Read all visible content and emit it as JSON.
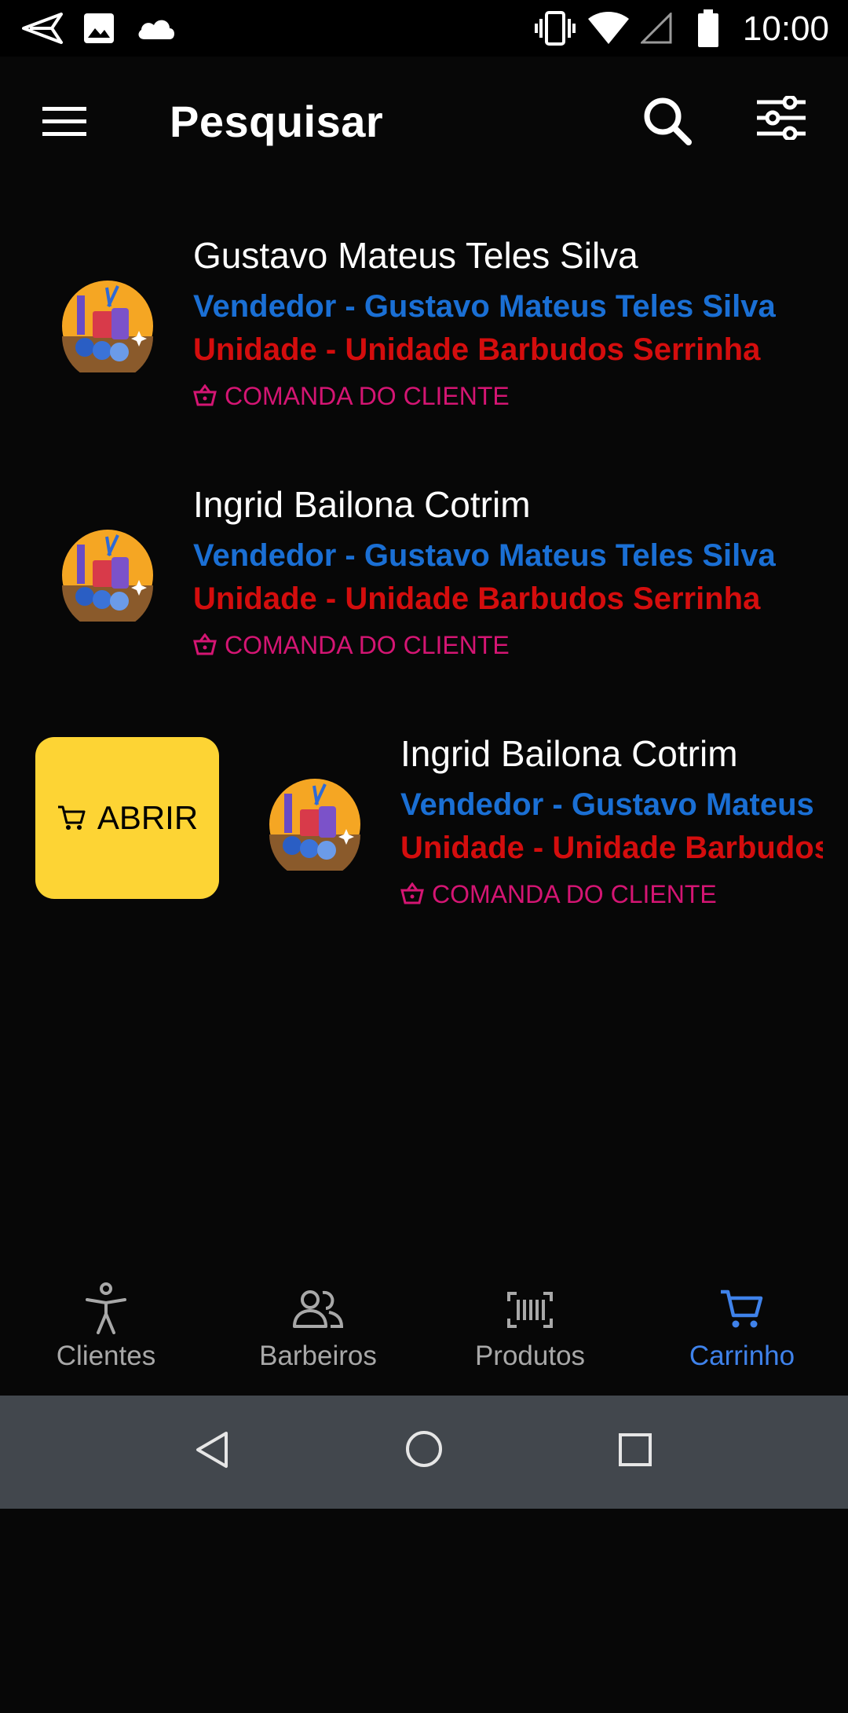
{
  "status_bar": {
    "time": "10:00"
  },
  "app_bar": {
    "title": "Pesquisar"
  },
  "items": [
    {
      "name": "Gustavo Mateus Teles Silva",
      "vendor": "Vendedor - Gustavo Mateus Teles Silva",
      "unit": "Unidade - Unidade Barbudos Serrinha",
      "tag": "COMANDA DO CLIENTE"
    },
    {
      "name": "Ingrid Bailona Cotrim",
      "vendor": "Vendedor - Gustavo Mateus Teles Silva",
      "unit": "Unidade - Unidade Barbudos Serrinha",
      "tag": "COMANDA DO CLIENTE"
    },
    {
      "name": "Ingrid Bailona Cotrim",
      "vendor": "Vendedor - Gustavo Mateus Teles Silva",
      "unit": "Unidade - Unidade Barbudos Serrinha",
      "tag": "COMANDA DO CLIENTE"
    }
  ],
  "swipe_action": {
    "label": "ABRIR",
    "icon": "cart-icon"
  },
  "bottom_nav": [
    {
      "label": "Clientes",
      "icon": "person-icon",
      "active": false
    },
    {
      "label": "Barbeiros",
      "icon": "people-icon",
      "active": false
    },
    {
      "label": "Produtos",
      "icon": "barcode-icon",
      "active": false
    },
    {
      "label": "Carrinho",
      "icon": "cart-icon",
      "active": true
    }
  ],
  "colors": {
    "background": "#070707",
    "vendor_text": "#1a6fd4",
    "unit_text": "#d40d0d",
    "tag_text": "#d41573",
    "swipe_button": "#fdd434",
    "nav_active": "#3f82ea",
    "nav_inactive": "#a8a8a8",
    "system_nav": "#42474d"
  }
}
